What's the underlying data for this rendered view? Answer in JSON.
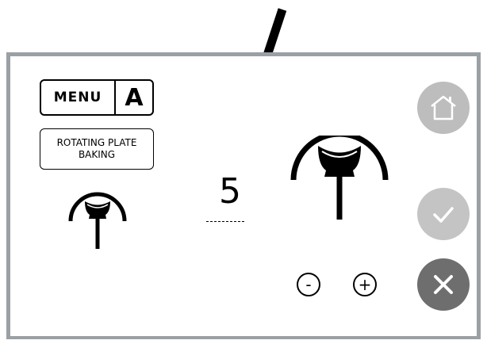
{
  "menu": {
    "label": "MENU",
    "letter": "A"
  },
  "mode": {
    "line1": "ROTATING PLATE",
    "line2": "BAKING"
  },
  "setting": {
    "value": "5"
  },
  "stepper": {
    "minus_label": "-",
    "plus_label": "+"
  },
  "icons": {
    "pointer": "pointer-arrow-icon",
    "home": "home-icon",
    "confirm": "check-icon",
    "cancel": "close-icon",
    "plate": "rotating-plate-icon"
  },
  "colors": {
    "panel_border": "#9aa0a4",
    "home_button": "#bdbdbd",
    "confirm_button": "#c4c4c4",
    "cancel_button": "#6e6e6e"
  }
}
